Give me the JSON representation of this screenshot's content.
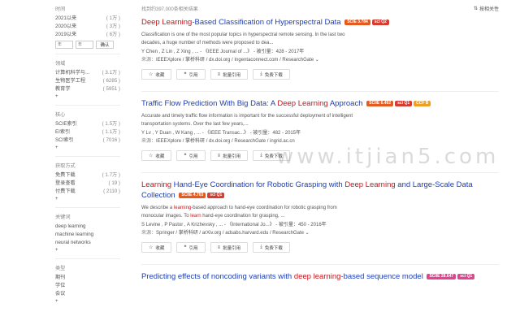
{
  "sidebar": {
    "time": {
      "title": "时间",
      "items": [
        {
          "label": "2021以来",
          "count": "( 1万 )"
        },
        {
          "label": "2020以来",
          "count": "( 3万 )"
        },
        {
          "label": "2019以来",
          "count": "( 6万 )"
        }
      ],
      "from_placeholder": "年",
      "to_placeholder": "年",
      "confirm": "确认"
    },
    "field": {
      "title": "领域",
      "items": [
        {
          "label": "计算机科学与...",
          "count": "( 3.1万 )"
        },
        {
          "label": "生物医学工程",
          "count": "( 6285 )"
        },
        {
          "label": "教育学",
          "count": "( 5951 )"
        }
      ],
      "expand": "+"
    },
    "core": {
      "title": "核心",
      "items": [
        {
          "label": "SCIE索引",
          "count": "( 1.5万 )"
        },
        {
          "label": "EI索引",
          "count": "( 1.1万 )"
        },
        {
          "label": "SCI索引",
          "count": "( 7016 )"
        }
      ],
      "expand": "+"
    },
    "access": {
      "title": "获取方式",
      "items": [
        {
          "label": "免费下载",
          "count": "( 1.7万 )"
        },
        {
          "label": "登录查看",
          "count": "( 19 )"
        },
        {
          "label": "付费下载",
          "count": "( 2110 )"
        }
      ],
      "expand": "+"
    },
    "keywords": {
      "title": "关键词",
      "items": [
        "deep learning",
        "machine learning",
        "neural networks"
      ],
      "expand": "+"
    },
    "type": {
      "title": "类型",
      "items": [
        "期刊",
        "学位",
        "会议"
      ],
      "expand": "+"
    }
  },
  "topbar": {
    "result_count": "找到约397,000条相关结果",
    "sort": "按相关性"
  },
  "actions": {
    "save": "收藏",
    "cite": "引用",
    "bulk_cite": "批量引用",
    "free_download": "免费下载"
  },
  "results": [
    {
      "title_hl": "Deep Learning",
      "title_rest": "-Based Classification of Hyperspectral Data",
      "badges": [
        "SCIE 3.784",
        "sci Q2"
      ],
      "abstract": "Classification is one of the most popular topics in hyperspectral remote sensing. In the last two decades, a huge number of methods were proposed to dea...",
      "meta": "Y Chen ,   Z Lin ,   Z Xing ,  ...  - 《IEEE Journal of ...》 - 被引量：428 - 2017年",
      "source_label": "来源：",
      "sources": "IEEEXplore / 掌桥科研 / dx.doi.org / Ingentaconnect.com / ResearchGate ⌄"
    },
    {
      "title_pre": "Traffic Flow Prediction With Big Data: A ",
      "title_hl": "Deep Learning",
      "title_rest": " Approach",
      "badges": [
        "SCIIE 6.492",
        "sci Q1",
        "CCF B"
      ],
      "abstract": "Accurate and timely traffic flow information is important for the successful deployment of intelligent transportation systems. Over the last few years,...",
      "meta": "Y Lv ,   Y Duan ,   W Kang ,  ...  - 《IEEE Transac...》 - 被引量：482 - 2015年",
      "source_label": "来源：",
      "sources": "IEEEXplore / 掌桥科研 / dx.doi.org / ResearchGate / ingrid.ac.cn"
    },
    {
      "title_hl": "Learning",
      "title_mid": " Hand-Eye Coordination for Robotic Grasping with ",
      "title_hl2": "Deep Learning",
      "title_rest": " and Large-Scale Data Collection",
      "badges": [
        "SCIIE 4.703",
        "sci Q1"
      ],
      "abstract_pre": "We describe a ",
      "abstract_hl": "learning",
      "abstract_mid": "-based approach to hand-eye coordination for robotic grasping from monocular images. To ",
      "abstract_hl2": "learn",
      "abstract_rest": " hand-eye coordination for grasping, ...",
      "meta": "S Levine ,   P Pastor ,   A Krizhevsky ,  ...  - 《International Jo...》 - 被引量：450 - 2016年",
      "source_label": "来源：",
      "sources": "Springer / 掌桥科研 / arXiv.org / adsabs.harvard.edu / ResearchGate ⌄"
    },
    {
      "title_pre": "Predicting effects of noncoding variants with ",
      "title_hl": "deep learning",
      "title_rest": "-based sequence model",
      "badges": [
        "SCIIE 28.647",
        "sci Q1"
      ]
    }
  ],
  "watermark": "www.itjian5.com",
  "colors": {
    "title_blue": "#1c3fb7",
    "highlight_red": "#c8161d",
    "scie_orange": "#e55a1f",
    "sci_red": "#d63c2f",
    "ccf_yellow": "#f0a020",
    "scie_pink": "#e04690"
  }
}
